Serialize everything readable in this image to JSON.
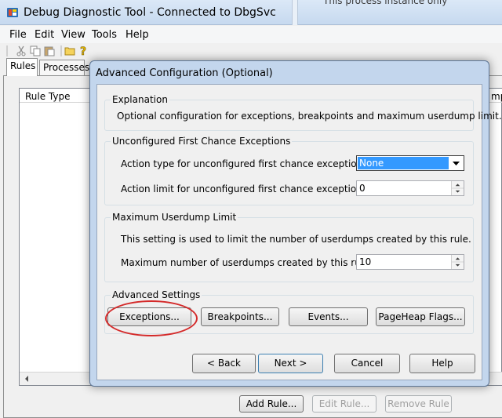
{
  "window": {
    "title": "Debug Diagnostic Tool - Connected to DbgSvc",
    "background_title_fragment": "This process instance only"
  },
  "menu": [
    "File",
    "Edit",
    "View",
    "Tools",
    "Help"
  ],
  "toolbar_icons": [
    "cut-icon",
    "copy-icon",
    "paste-icon",
    "folder-icon",
    "help-icon"
  ],
  "tabs": [
    {
      "label": "Rules",
      "active": true
    },
    {
      "label": "Processes",
      "active": false
    }
  ],
  "rules_list": {
    "column_rule_type": "Rule Type",
    "column_partial": "mp"
  },
  "bottom_buttons": {
    "add_rule": "Add Rule...",
    "edit_rule": "Edit Rule...",
    "remove_rule": "Remove Rule"
  },
  "dialog": {
    "title": "Advanced Configuration (Optional)",
    "explanation": {
      "legend": "Explanation",
      "text": "Optional configuration for exceptions, breakpoints and maximum userdump limit."
    },
    "first_chance": {
      "legend": "Unconfigured First Chance Exceptions",
      "action_type_label": "Action type for unconfigured first chance exceptions:",
      "action_type_value": "None",
      "action_limit_label": "Action limit for unconfigured first chance exceptions:",
      "action_limit_value": "0"
    },
    "userdump": {
      "legend": "Maximum Userdump Limit",
      "description": "This setting is used to limit the number of userdumps created by this rule.",
      "max_label": "Maximum number of userdumps created by this rule:",
      "max_value": "10"
    },
    "advanced": {
      "legend": "Advanced Settings",
      "exceptions": "Exceptions...",
      "breakpoints": "Breakpoints...",
      "events": "Events...",
      "pageheap": "PageHeap Flags..."
    },
    "nav": {
      "back": "< Back",
      "next": "Next >",
      "cancel": "Cancel",
      "help": "Help"
    }
  },
  "annotation": {
    "highlight_color": "#d42a2a",
    "highlights": "exceptions-button"
  }
}
